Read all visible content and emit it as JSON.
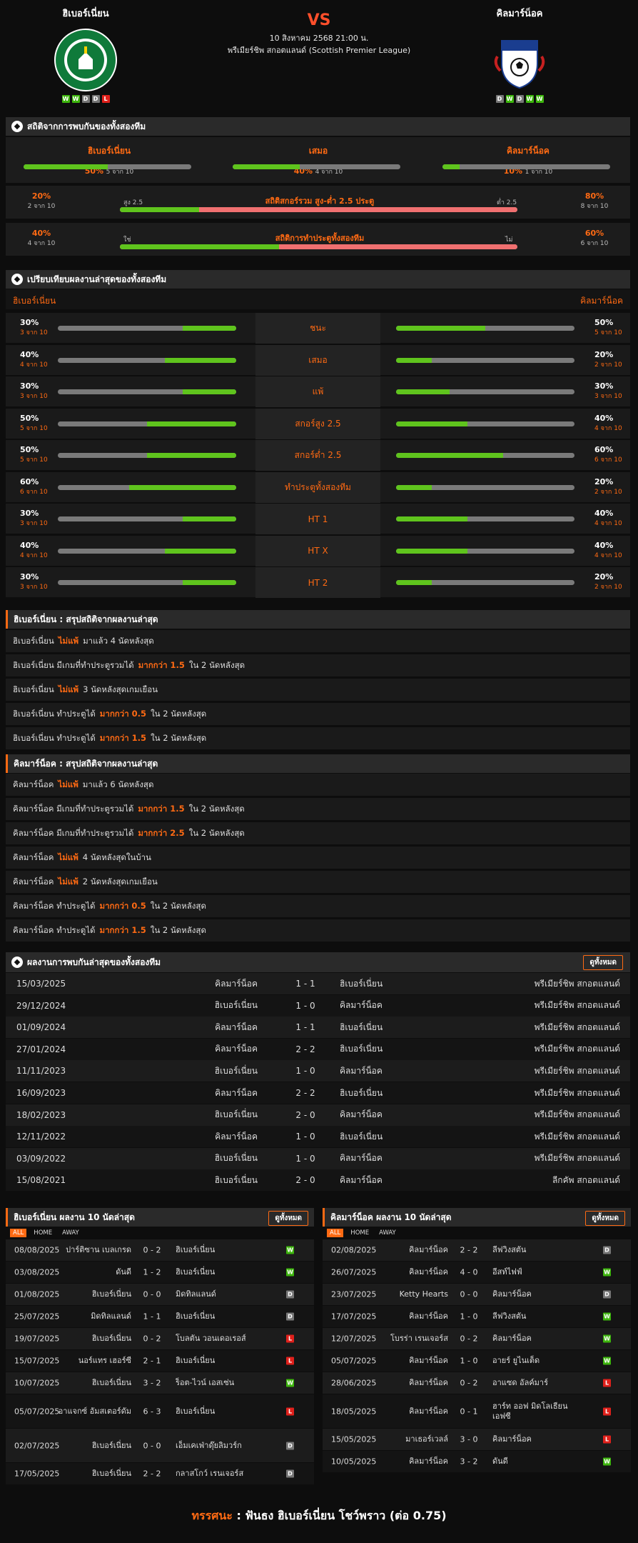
{
  "header": {
    "home": {
      "name": "ฮิเบอร์เนี่ยน",
      "form": [
        "W",
        "W",
        "D",
        "D",
        "L"
      ]
    },
    "away": {
      "name": "คิลมาร์น็อค",
      "form": [
        "D",
        "W",
        "D",
        "W",
        "W"
      ]
    },
    "vs": "VS",
    "datetime": "10 สิงหาคม 2568 21:00 น.",
    "league": "พรีเมียร์ชิพ สกอตแลนด์ (Scottish Premier League)"
  },
  "h2h_stats": {
    "title": "สถิติจากการพบกันของทั้งสองทีม",
    "items": [
      {
        "label": "ฮิเบอร์เนี่ยน",
        "pct": "50%",
        "sub": "5 จาก 10",
        "fill": 50
      },
      {
        "label": "เสมอ",
        "pct": "40%",
        "sub": "4 จาก 10",
        "fill": 40
      },
      {
        "label": "คิลมาร์น็อค",
        "pct": "10%",
        "sub": "1 จาก 10",
        "fill": 10
      }
    ],
    "ou": {
      "left_pct": "20%",
      "left_sub": "2 จาก 10",
      "left_tag": "สูง 2.5",
      "title": "สถิติสกอร์รวม สูง-ต่ำ 2.5 ประตู",
      "right_tag": "ต่ำ 2.5",
      "right_pct": "80%",
      "right_sub": "8 จาก 10",
      "fill": 20
    },
    "btts": {
      "left_pct": "40%",
      "left_sub": "4 จาก 10",
      "left_tag": "ใช่",
      "title": "สถิติการทำประตูทั้งสองทีม",
      "right_tag": "ไม่",
      "right_pct": "60%",
      "right_sub": "6 จาก 10",
      "fill": 40
    }
  },
  "compare": {
    "title": "เปรียบเทียบผลงานล่าสุดของทั้งสองทีม",
    "home": "ฮิเบอร์เนี่ยน",
    "away": "คิลมาร์น็อค",
    "rows": [
      {
        "label": "ชนะ",
        "hp": "30%",
        "hs": "3 จาก 10",
        "hf": 30,
        "ap": "50%",
        "as": "5 จาก 10",
        "af": 50
      },
      {
        "label": "เสมอ",
        "hp": "40%",
        "hs": "4 จาก 10",
        "hf": 40,
        "ap": "20%",
        "as": "2 จาก 10",
        "af": 20
      },
      {
        "label": "แพ้",
        "hp": "30%",
        "hs": "3 จาก 10",
        "hf": 30,
        "ap": "30%",
        "as": "3 จาก 10",
        "af": 30
      },
      {
        "label": "สกอร์สูง 2.5",
        "hp": "50%",
        "hs": "5 จาก 10",
        "hf": 50,
        "ap": "40%",
        "as": "4 จาก 10",
        "af": 40
      },
      {
        "label": "สกอร์ต่ำ 2.5",
        "hp": "50%",
        "hs": "5 จาก 10",
        "hf": 50,
        "ap": "60%",
        "as": "6 จาก 10",
        "af": 60
      },
      {
        "label": "ทำประตูทั้งสองทีม",
        "hp": "60%",
        "hs": "6 จาก 10",
        "hf": 60,
        "ap": "20%",
        "as": "2 จาก 10",
        "af": 20
      },
      {
        "label": "HT 1",
        "hp": "30%",
        "hs": "3 จาก 10",
        "hf": 30,
        "ap": "40%",
        "as": "4 จาก 10",
        "af": 40
      },
      {
        "label": "HT X",
        "hp": "40%",
        "hs": "4 จาก 10",
        "hf": 40,
        "ap": "40%",
        "as": "4 จาก 10",
        "af": 40
      },
      {
        "label": "HT 2",
        "hp": "30%",
        "hs": "3 จาก 10",
        "hf": 30,
        "ap": "20%",
        "as": "2 จาก 10",
        "af": 20
      }
    ]
  },
  "home_summary": {
    "title": "ฮิเบอร์เนี่ยน : สรุปสถิติจากผลงานล่าสุด",
    "lines": [
      [
        "ฮิเบอร์เนี่ยน",
        "ไม่แพ้",
        "มาแล้ว 4 นัดหลังสุด"
      ],
      [
        "ฮิเบอร์เนี่ยน มีเกมที่ทำประตูรวมได้",
        "มากกว่า 1.5",
        "ใน 2 นัดหลังสุด"
      ],
      [
        "ฮิเบอร์เนี่ยน",
        "ไม่แพ้",
        "3 นัดหลังสุดเกมเยือน"
      ],
      [
        "ฮิเบอร์เนี่ยน ทำประตูได้",
        "มากกว่า 0.5",
        "ใน 2 นัดหลังสุด"
      ],
      [
        "ฮิเบอร์เนี่ยน ทำประตูได้",
        "มากกว่า 1.5",
        "ใน 2 นัดหลังสุด"
      ]
    ]
  },
  "away_summary": {
    "title": "คิลมาร์น็อค : สรุปสถิติจากผลงานล่าสุด",
    "lines": [
      [
        "คิลมาร์น็อค",
        "ไม่แพ้",
        "มาแล้ว 6 นัดหลังสุด"
      ],
      [
        "คิลมาร์น็อค มีเกมที่ทำประตูรวมได้",
        "มากกว่า 1.5",
        "ใน 2 นัดหลังสุด"
      ],
      [
        "คิลมาร์น็อค มีเกมที่ทำประตูรวมได้",
        "มากกว่า 2.5",
        "ใน 2 นัดหลังสุด"
      ],
      [
        "คิลมาร์น็อค",
        "ไม่แพ้",
        "4 นัดหลังสุดในบ้าน"
      ],
      [
        "คิลมาร์น็อค",
        "ไม่แพ้",
        "2 นัดหลังสุดเกมเยือน"
      ],
      [
        "คิลมาร์น็อค ทำประตูได้",
        "มากกว่า 0.5",
        "ใน 2 นัดหลังสุด"
      ],
      [
        "คิลมาร์น็อค ทำประตูได้",
        "มากกว่า 1.5",
        "ใน 2 นัดหลังสุด"
      ]
    ]
  },
  "h2h_results": {
    "title": "ผลงานการพบกันล่าสุดของทั้งสองทีม",
    "view_all": "ดูทั้งหมด",
    "rows": [
      [
        "15/03/2025",
        "คิลมาร์น็อค",
        "1 - 1",
        "ฮิเบอร์เนี่ยน",
        "พรีเมียร์ชิพ สกอตแลนด์"
      ],
      [
        "29/12/2024",
        "ฮิเบอร์เนี่ยน",
        "1 - 0",
        "คิลมาร์น็อค",
        "พรีเมียร์ชิพ สกอตแลนด์"
      ],
      [
        "01/09/2024",
        "คิลมาร์น็อค",
        "1 - 1",
        "ฮิเบอร์เนี่ยน",
        "พรีเมียร์ชิพ สกอตแลนด์"
      ],
      [
        "27/01/2024",
        "คิลมาร์น็อค",
        "2 - 2",
        "ฮิเบอร์เนี่ยน",
        "พรีเมียร์ชิพ สกอตแลนด์"
      ],
      [
        "11/11/2023",
        "ฮิเบอร์เนี่ยน",
        "1 - 0",
        "คิลมาร์น็อค",
        "พรีเมียร์ชิพ สกอตแลนด์"
      ],
      [
        "16/09/2023",
        "คิลมาร์น็อค",
        "2 - 2",
        "ฮิเบอร์เนี่ยน",
        "พรีเมียร์ชิพ สกอตแลนด์"
      ],
      [
        "18/02/2023",
        "ฮิเบอร์เนี่ยน",
        "2 - 0",
        "คิลมาร์น็อค",
        "พรีเมียร์ชิพ สกอตแลนด์"
      ],
      [
        "12/11/2022",
        "คิลมาร์น็อค",
        "1 - 0",
        "ฮิเบอร์เนี่ยน",
        "พรีเมียร์ชิพ สกอตแลนด์"
      ],
      [
        "03/09/2022",
        "ฮิเบอร์เนี่ยน",
        "1 - 0",
        "คิลมาร์น็อค",
        "พรีเมียร์ชิพ สกอตแลนด์"
      ],
      [
        "15/08/2021",
        "ฮิเบอร์เนี่ยน",
        "2 - 0",
        "คิลมาร์น็อค",
        "ลีกคัพ สกอตแลนด์"
      ]
    ]
  },
  "tabs": [
    "ALL",
    "HOME",
    "AWAY"
  ],
  "home_last10": {
    "title": "ฮิเบอร์เนี่ยน ผลงาน 10 นัดล่าสุด",
    "view_all": "ดูทั้งหมด",
    "rows": [
      [
        "08/08/2025",
        "ปาร์ติซาน เบลเกรด",
        "0 - 2",
        "ฮิเบอร์เนี่ยน",
        "W"
      ],
      [
        "03/08/2025",
        "ดันดี",
        "1 - 2",
        "ฮิเบอร์เนี่ยน",
        "W"
      ],
      [
        "01/08/2025",
        "ฮิเบอร์เนี่ยน",
        "0 - 0",
        "มิดทิลแลนด์",
        "D"
      ],
      [
        "25/07/2025",
        "มิดทิลแลนด์",
        "1 - 1",
        "ฮิเบอร์เนี่ยน",
        "D"
      ],
      [
        "19/07/2025",
        "ฮิเบอร์เนี่ยน",
        "0 - 2",
        "โบลตัน วอนเดอเรอส์",
        "L"
      ],
      [
        "15/07/2025",
        "นอร์แทร เฮอร์ซี",
        "2 - 1",
        "ฮิเบอร์เนี่ยน",
        "L"
      ],
      [
        "10/07/2025",
        "ฮิเบอร์เนี่ยน",
        "3 - 2",
        "ร็อต-ไวน์ เอสเซ่น",
        "W"
      ],
      [
        "05/07/2025",
        "อาแจกซ์ อัมสเตอร์ดัม",
        "6 - 3",
        "ฮิเบอร์เนี่ยน",
        "L"
      ],
      [
        "02/07/2025",
        "ฮิเบอร์เนี่ยน",
        "0 - 0",
        "เอ็มเคเฟ่าดุ๊ยลิมวร์ก",
        "D"
      ],
      [
        "17/05/2025",
        "ฮิเบอร์เนี่ยน",
        "2 - 2",
        "กลาสโกว์ เรนเจอร์ส",
        "D"
      ]
    ]
  },
  "away_last10": {
    "title": "คิลมาร์น็อค ผลงาน 10 นัดล่าสุด",
    "view_all": "ดูทั้งหมด",
    "rows": [
      [
        "02/08/2025",
        "คิลมาร์น็อค",
        "2 - 2",
        "ลีฟวิงสตัน",
        "D"
      ],
      [
        "26/07/2025",
        "คิลมาร์น็อค",
        "4 - 0",
        "อีสท์ไฟฟ์",
        "W"
      ],
      [
        "23/07/2025",
        "Ketty Hearts",
        "0 - 0",
        "คิลมาร์น็อค",
        "D"
      ],
      [
        "17/07/2025",
        "คิลมาร์น็อค",
        "1 - 0",
        "ลีฟวิงสตัน",
        "W"
      ],
      [
        "12/07/2025",
        "โบรร่า เรนเจอร์ส",
        "0 - 2",
        "คิลมาร์น็อค",
        "W"
      ],
      [
        "05/07/2025",
        "คิลมาร์น็อค",
        "1 - 0",
        "อายร์ ยูไนเต็ด",
        "W"
      ],
      [
        "28/06/2025",
        "คิลมาร์น็อค",
        "0 - 2",
        "อาแซด อัลค์มาร์",
        "L"
      ],
      [
        "18/05/2025",
        "คิลมาร์น็อค",
        "0 - 1",
        "ฮาร์ท ออฟ มิดโลเธียน เอฟซี",
        "L"
      ],
      [
        "15/05/2025",
        "มาเธอร์เวลล์",
        "3 - 0",
        "คิลมาร์น็อค",
        "L"
      ],
      [
        "10/05/2025",
        "คิลมาร์น็อค",
        "3 - 2",
        "ดันดี",
        "W"
      ]
    ]
  },
  "verdict": {
    "label": "ทรรศนะ",
    "text": ": ฟันธง ฮิเบอร์เนี่ยน โชว์พราว (ต่อ 0.75)"
  },
  "colors": {
    "accent": "#ff6a13",
    "win": "#3db50d",
    "draw": "#777777",
    "loss": "#e0201b",
    "bar_green": "#5fc41d",
    "bar_red": "#f07070"
  }
}
